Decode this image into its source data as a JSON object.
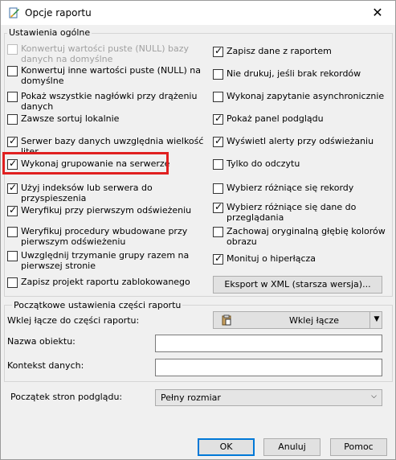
{
  "window": {
    "title": "Opcje raportu"
  },
  "general": {
    "legend": "Ustawienia ogólne",
    "left": [
      {
        "label": "Konwertuj wartości puste (NULL) bazy danych na domyślne",
        "checked": false,
        "disabled": true
      },
      {
        "label": "Konwertuj inne wartości puste (NULL) na domyślne",
        "checked": false,
        "disabled": false
      },
      {
        "label": "Pokaż wszystkie nagłówki przy drążeniu danych",
        "checked": false,
        "disabled": false
      },
      {
        "label": "Zawsze sortuj lokalnie",
        "checked": false,
        "disabled": false
      },
      {
        "label": "Serwer bazy danych uwzględnia wielkość liter",
        "checked": true,
        "disabled": false
      },
      {
        "label": "Wykonaj grupowanie na serwerze",
        "checked": true,
        "disabled": false
      },
      {
        "label": "Użyj indeksów lub serwera do przyspieszenia",
        "checked": true,
        "disabled": false
      },
      {
        "label": "Weryfikuj przy pierwszym odświeżeniu",
        "checked": true,
        "disabled": false
      },
      {
        "label": "Weryfikuj procedury wbudowane przy pierwszym odświeżeniu",
        "checked": false,
        "disabled": false
      },
      {
        "label": "Uwzględnij trzymanie grupy razem na pierwszej stronie",
        "checked": false,
        "disabled": false
      },
      {
        "label": "Zapisz projekt raportu zablokowanego",
        "checked": false,
        "disabled": false
      }
    ],
    "right": [
      {
        "label": "Zapisz dane z raportem",
        "checked": true,
        "disabled": false
      },
      {
        "label": "Nie drukuj, jeśli brak rekordów",
        "checked": false,
        "disabled": false
      },
      {
        "label": "Wykonaj zapytanie asynchronicznie",
        "checked": false,
        "disabled": false
      },
      {
        "label": "Pokaż panel podglądu",
        "checked": true,
        "disabled": false
      },
      {
        "label": "Wyświetl alerty przy odświeżaniu",
        "checked": true,
        "disabled": false
      },
      {
        "label": "Tylko do odczytu",
        "checked": false,
        "disabled": false
      },
      {
        "label": "Wybierz różniące się rekordy",
        "checked": false,
        "disabled": false
      },
      {
        "label": "Wybierz różniące się dane do przeglądania",
        "checked": true,
        "disabled": false
      },
      {
        "label": "Zachowaj oryginalną głębię kolorów obrazu",
        "checked": false,
        "disabled": false
      },
      {
        "label": "Monituj o hiperłącza",
        "checked": true,
        "disabled": false
      }
    ],
    "export_button": "Eksport w XML (starsza wersja)..."
  },
  "section": {
    "legend": "Początkowe ustawienia części raportu",
    "paste_link_label": "Wklej łącze do części raportu:",
    "paste_link_button": "Wklej łącze",
    "object_name_label": "Nazwa obiektu:",
    "object_name_value": "",
    "data_context_label": "Kontekst danych:",
    "data_context_value": ""
  },
  "preview": {
    "label": "Początek stron podglądu:",
    "selected": "Pełny rozmiar"
  },
  "buttons": {
    "ok": "OK",
    "cancel": "Anuluj",
    "help": "Pomoc"
  }
}
